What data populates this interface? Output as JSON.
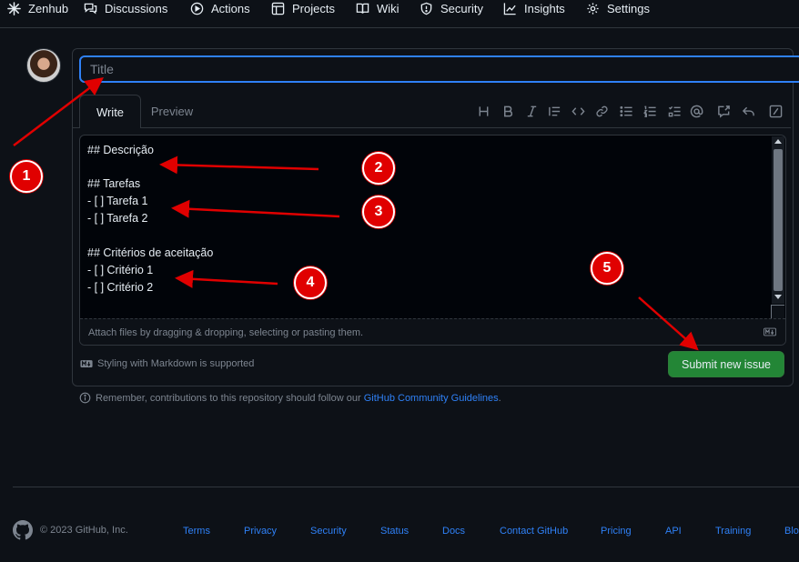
{
  "nav": {
    "items": [
      {
        "label": "Zenhub",
        "icon": "zenhub-icon"
      },
      {
        "label": "Discussions",
        "icon": "comment-discussion-icon"
      },
      {
        "label": "Actions",
        "icon": "play-icon"
      },
      {
        "label": "Projects",
        "icon": "table-icon"
      },
      {
        "label": "Wiki",
        "icon": "book-icon"
      },
      {
        "label": "Security",
        "icon": "shield-icon"
      },
      {
        "label": "Insights",
        "icon": "graph-icon"
      },
      {
        "label": "Settings",
        "icon": "gear-icon"
      }
    ]
  },
  "form": {
    "title_placeholder": "Title",
    "tabs": {
      "write": "Write",
      "preview": "Preview"
    },
    "toolbar": [
      "heading-icon",
      "bold-icon",
      "italic-icon",
      "quote-icon",
      "code-icon",
      "link-icon",
      "unordered-list-icon",
      "ordered-list-icon",
      "task-list-icon",
      "mention-icon",
      "cross-reference-icon",
      "reply-icon",
      "slash-command-icon"
    ],
    "body_lines": [
      "## Descrição",
      "",
      "## Tarefas",
      "- [ ] Tarefa 1",
      "- [ ] Tarefa 2",
      "",
      "## Critérios de aceitação",
      "- [ ] Critério 1",
      "- [ ] Critério 2"
    ],
    "attach_text": "Attach files by dragging & dropping, selecting or pasting them.",
    "markdown_note": "Styling with Markdown is supported",
    "submit_label": "Submit new issue"
  },
  "remember": {
    "text": "Remember, contributions to this repository should follow our",
    "link": "GitHub Community Guidelines",
    "suffix": "."
  },
  "footer": {
    "copyright": "© 2023 GitHub, Inc.",
    "links": [
      "Terms",
      "Privacy",
      "Security",
      "Status",
      "Docs",
      "Contact GitHub",
      "Pricing",
      "API",
      "Training",
      "Blo"
    ]
  },
  "annotations": {
    "callouts": [
      "1",
      "2",
      "3",
      "4",
      "5"
    ],
    "arrow_color": "#e00000"
  },
  "colors": {
    "accent": "#2f81f7",
    "submit": "#238636",
    "background": "#0d1117"
  }
}
